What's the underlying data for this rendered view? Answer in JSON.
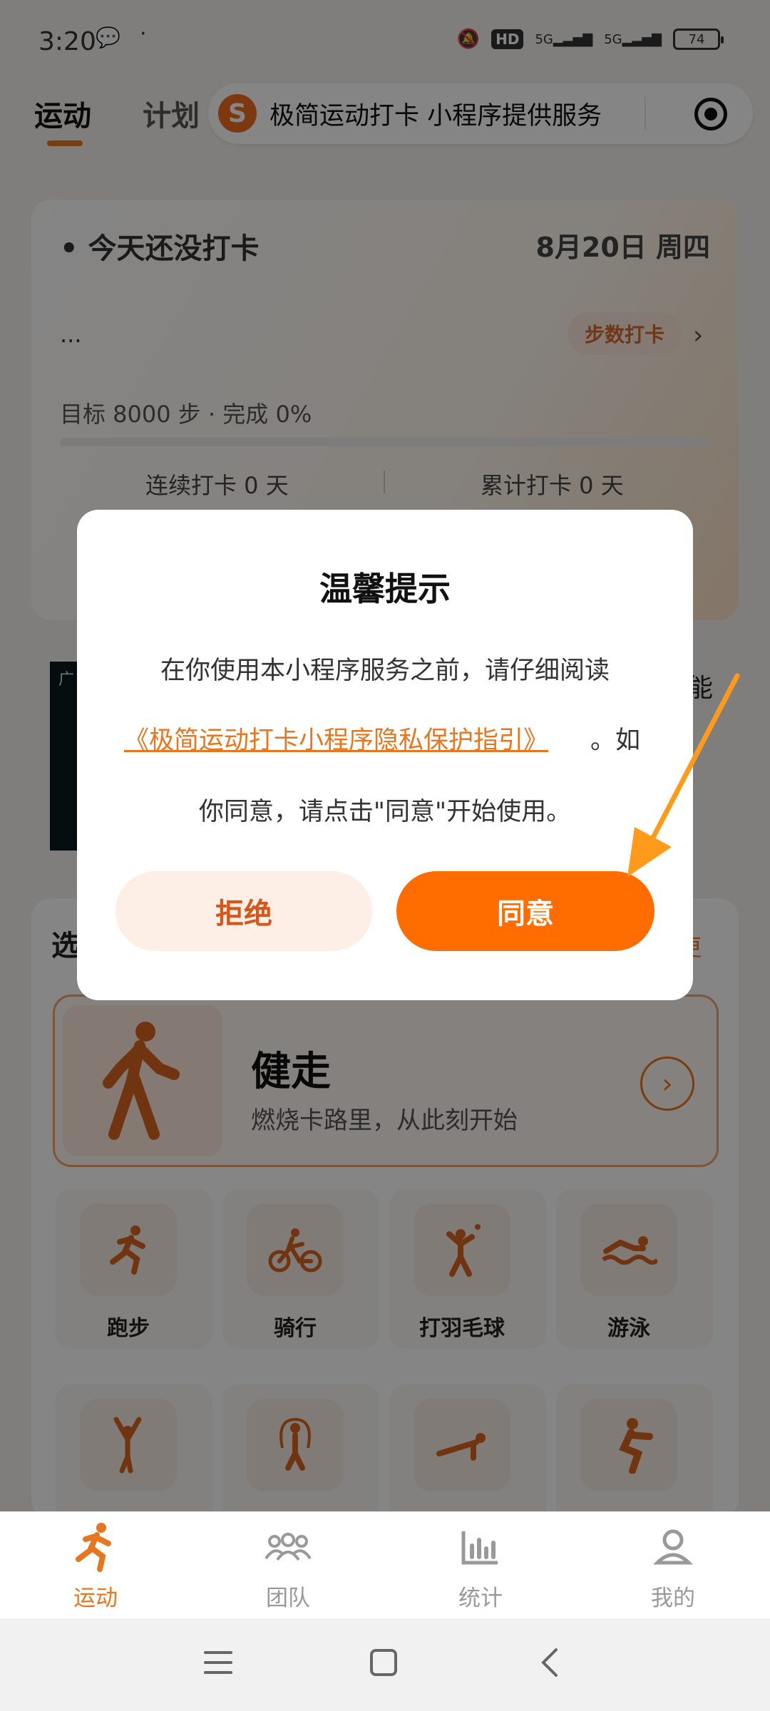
{
  "status_bar": {
    "time": "3:20",
    "hd": "HD",
    "net1": "5G",
    "net2": "5G",
    "battery": "74"
  },
  "top_tabs": {
    "active": "运动",
    "second": "计划"
  },
  "capsule": {
    "logo_letter": "S",
    "title": "极简运动打卡 小程序提供服务"
  },
  "checkin_card": {
    "status": "• 今天还没打卡",
    "date": "8月20日 周四",
    "dots": "...",
    "step_button": "步数打卡",
    "goal_text": "目标 8000 步 · 完成 0%",
    "progress_percent": 0,
    "streak": "连续打卡 0 天",
    "total": "累计打卡 0 天"
  },
  "banner": {
    "label": "广",
    "side_text": "能"
  },
  "section": {
    "heading": "选",
    "more": "更"
  },
  "featured": {
    "title": "健走",
    "subtitle": "燃烧卡路里，从此刻开始"
  },
  "sports_row1": [
    "跑步",
    "骑行",
    "打羽毛球",
    "游泳"
  ],
  "sports_row2": [
    "瑜伽",
    "跳绳",
    "俯卧撑",
    "深蹲"
  ],
  "dialog": {
    "title": "温馨提示",
    "line1": "在你使用本小程序服务之前，请仔细阅读",
    "link": "《极简运动打卡小程序隐私保护指引》",
    "link_tail": "。如",
    "line3": "你同意，请点击\"同意\"开始使用。",
    "reject": "拒绝",
    "agree": "同意"
  },
  "bottom_nav": {
    "items": [
      "运动",
      "团队",
      "统计",
      "我的"
    ],
    "active_index": 0
  },
  "colors": {
    "accent": "#ff6d00",
    "accent_light": "#fdeee6",
    "annotation_arrow": "#ff9a1a"
  }
}
